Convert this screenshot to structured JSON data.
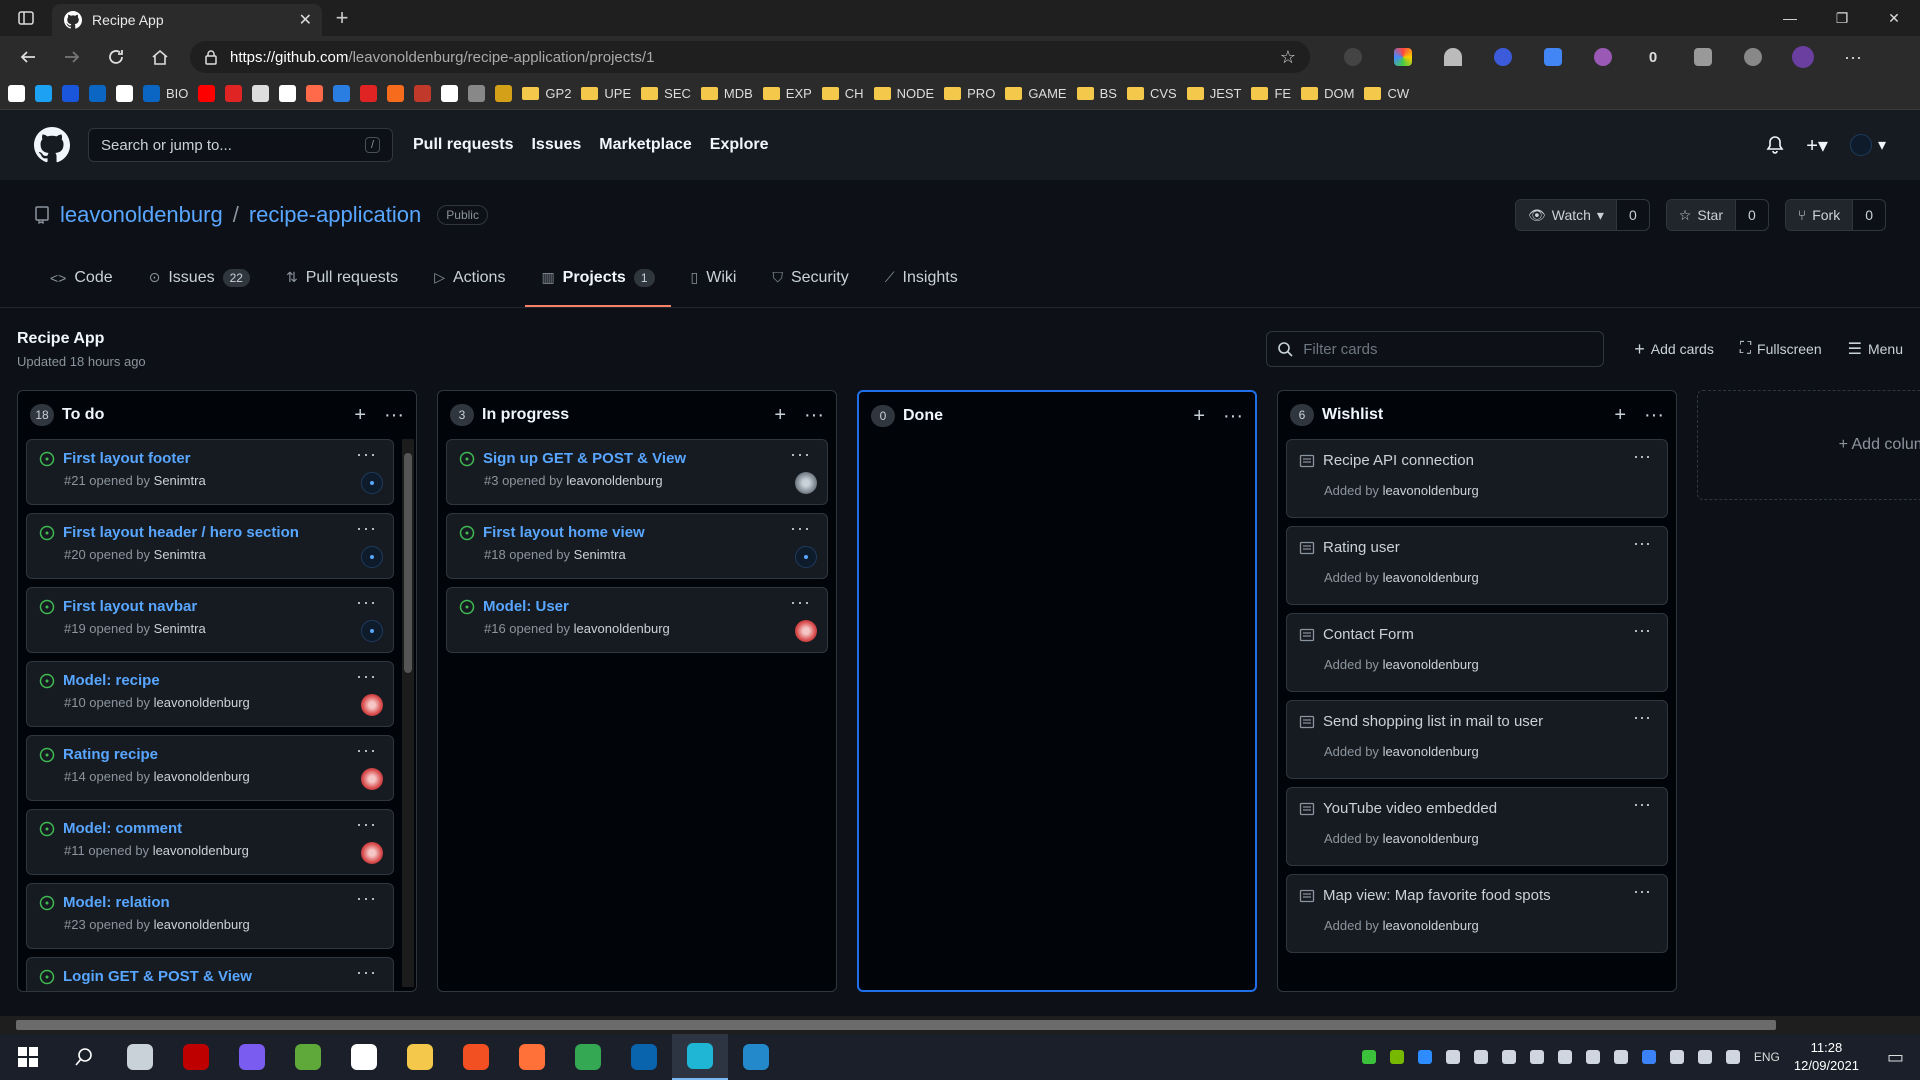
{
  "browser": {
    "tab_title": "Recipe App",
    "url_host": "https://github.com",
    "url_path": "/leavonoldenburg/recipe-application/projects/1",
    "extension_count_label": "0",
    "bookmarks": [
      {
        "type": "icon",
        "color": "#ffffff"
      },
      {
        "type": "icon",
        "color": "#1da1f2"
      },
      {
        "type": "icon",
        "color": "#1a56db"
      },
      {
        "type": "icon",
        "color": "#0a66c2"
      },
      {
        "type": "icon",
        "color": "#ffffff"
      },
      {
        "type": "label",
        "text": "BIO",
        "color": "#0a66c2"
      },
      {
        "type": "icon",
        "color": "#ff0000"
      },
      {
        "type": "icon",
        "color": "#e02424"
      },
      {
        "type": "icon",
        "color": "#dddddd"
      },
      {
        "type": "icon",
        "color": "#ffffff"
      },
      {
        "type": "icon",
        "color": "#ff6b4a"
      },
      {
        "type": "icon",
        "color": "#2a7de1"
      },
      {
        "type": "icon",
        "color": "#e02424"
      },
      {
        "type": "icon",
        "color": "#f76b1c"
      },
      {
        "type": "icon",
        "color": "#c0392b"
      },
      {
        "type": "icon",
        "color": "#ffffff"
      },
      {
        "type": "icon",
        "color": "#888888"
      },
      {
        "type": "icon",
        "color": "#d4a017"
      }
    ],
    "bookmark_folders": [
      "GP2",
      "UPE",
      "SEC",
      "MDB",
      "EXP",
      "CH",
      "NODE",
      "PRO",
      "GAME",
      "BS",
      "CVS",
      "JEST",
      "FE",
      "DOM",
      "CW"
    ]
  },
  "github": {
    "search_placeholder": "Search or jump to...",
    "search_shortcut": "/",
    "nav": [
      "Pull requests",
      "Issues",
      "Marketplace",
      "Explore"
    ],
    "repo_owner": "leavonoldenburg",
    "repo_sep": "/",
    "repo_name": "recipe-application",
    "visibility": "Public",
    "watch_label": "Watch",
    "watch_count": "0",
    "star_label": "Star",
    "star_count": "0",
    "fork_label": "Fork",
    "fork_count": "0",
    "tabs": [
      {
        "label": "Code",
        "icon": "code-icon"
      },
      {
        "label": "Issues",
        "count": "22",
        "icon": "issue-icon"
      },
      {
        "label": "Pull requests",
        "icon": "pull-request-icon"
      },
      {
        "label": "Actions",
        "icon": "play-icon"
      },
      {
        "label": "Projects",
        "count": "1",
        "icon": "project-icon",
        "active": true
      },
      {
        "label": "Wiki",
        "icon": "book-icon"
      },
      {
        "label": "Security",
        "icon": "shield-icon"
      },
      {
        "label": "Insights",
        "icon": "graph-icon"
      }
    ]
  },
  "project": {
    "name": "Recipe App",
    "updated": "Updated 18 hours ago",
    "filter_placeholder": "Filter cards",
    "add_cards": "Add cards",
    "fullscreen": "Fullscreen",
    "menu": "Menu",
    "add_column": "+ Add column",
    "columns": [
      {
        "name": "To do",
        "count": "18",
        "cards": [
          {
            "title": "First layout footer",
            "meta_prefix": "#21 opened by",
            "author": "Senimtra",
            "avatar": "dark"
          },
          {
            "title": "First layout header / hero section",
            "meta_prefix": "#20 opened by",
            "author": "Senimtra",
            "avatar": "dark"
          },
          {
            "title": "First layout navbar",
            "meta_prefix": "#19 opened by",
            "author": "Senimtra",
            "avatar": "dark"
          },
          {
            "title": "Model: recipe",
            "meta_prefix": "#10 opened by",
            "author": "leavonoldenburg",
            "avatar": "red"
          },
          {
            "title": "Rating recipe",
            "meta_prefix": "#14 opened by",
            "author": "leavonoldenburg",
            "avatar": "red"
          },
          {
            "title": "Model: comment",
            "meta_prefix": "#11 opened by",
            "author": "leavonoldenburg",
            "avatar": "red"
          },
          {
            "title": "Model: relation",
            "meta_prefix": "#23 opened by",
            "author": "leavonoldenburg",
            "avatar": "none"
          },
          {
            "title": "Login GET & POST & View",
            "meta_prefix": "",
            "author": "",
            "avatar": "none"
          }
        ]
      },
      {
        "name": "In progress",
        "count": "3",
        "cards": [
          {
            "title": "Sign up GET & POST & View",
            "meta_prefix": "#3 opened by",
            "author": "leavonoldenburg",
            "avatar": "gray"
          },
          {
            "title": "First layout home view",
            "meta_prefix": "#18 opened by",
            "author": "Senimtra",
            "avatar": "dark"
          },
          {
            "title": "Model: User",
            "meta_prefix": "#16 opened by",
            "author": "leavonoldenburg",
            "avatar": "red"
          }
        ]
      },
      {
        "name": "Done",
        "count": "0",
        "cards": []
      },
      {
        "name": "Wishlist",
        "count": "6",
        "notes": [
          {
            "title": "Recipe API connection",
            "meta_prefix": "Added by",
            "author": "leavonoldenburg"
          },
          {
            "title": "Rating user",
            "meta_prefix": "Added by",
            "author": "leavonoldenburg"
          },
          {
            "title": "Contact Form",
            "meta_prefix": "Added by",
            "author": "leavonoldenburg"
          },
          {
            "title": "Send shopping list in mail to user",
            "meta_prefix": "Added by",
            "author": "leavonoldenburg"
          },
          {
            "title": "YouTube video embedded",
            "meta_prefix": "Added by",
            "author": "leavonoldenburg"
          },
          {
            "title": "Map view: Map favorite food spots",
            "meta_prefix": "Added by",
            "author": "leavonoldenburg"
          }
        ]
      }
    ]
  },
  "taskbar": {
    "apps": [
      {
        "name": "search-icon",
        "color": "#ffffff"
      },
      {
        "name": "app-icon",
        "color": "#c9d1d9"
      },
      {
        "name": "filezilla-icon",
        "color": "#bf0000"
      },
      {
        "name": "app-icon",
        "color": "#7b5cf0"
      },
      {
        "name": "app-icon",
        "color": "#5fa83a"
      },
      {
        "name": "app-icon",
        "color": "#ffffff"
      },
      {
        "name": "file-explorer-icon",
        "color": "#f4c84a"
      },
      {
        "name": "store-icon",
        "color": "#f25022"
      },
      {
        "name": "firefox-icon",
        "color": "#ff7139"
      },
      {
        "name": "chrome-icon",
        "color": "#34a853"
      },
      {
        "name": "outlook-icon",
        "color": "#0a64ad"
      },
      {
        "name": "edge-icon",
        "color": "#1fb5d4",
        "active": true
      },
      {
        "name": "vscode-icon",
        "color": "#2489ca"
      }
    ],
    "lang": "ENG",
    "time": "11:28",
    "date": "12/09/2021"
  }
}
